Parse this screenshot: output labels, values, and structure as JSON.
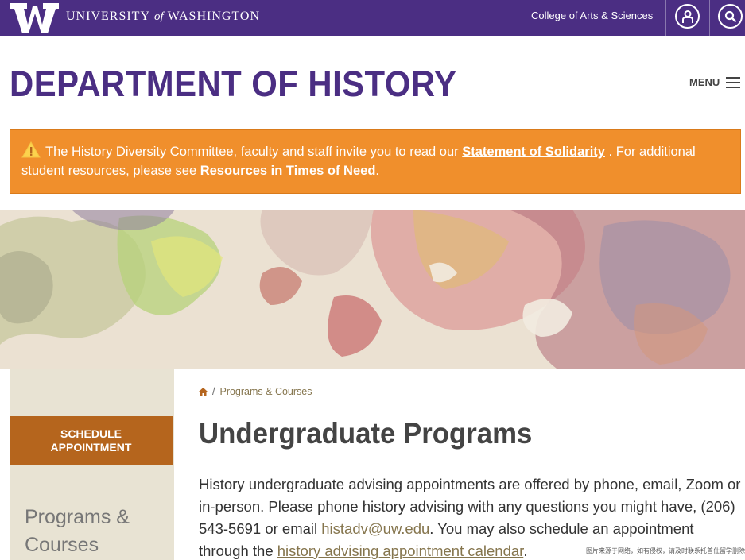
{
  "topbar": {
    "wordmark_pre": "UNIVERSITY",
    "wordmark_of": "of",
    "wordmark_post": "WASHINGTON",
    "college_link": "College of Arts & Sciences",
    "account_icon": "user-icon",
    "search_icon": "search-icon"
  },
  "header": {
    "title": "DEPARTMENT OF HISTORY",
    "menu_label": "MENU"
  },
  "alert": {
    "text_1": "The History Diversity Committee, faculty and staff invite you to read our ",
    "link_1": "Statement of Solidarity",
    "text_2": " . For additional student resources, please see ",
    "link_2": "Resources in Times of Need",
    "text_3": "."
  },
  "sidebar": {
    "schedule_line1": "SCHEDULE",
    "schedule_line2": "APPOINTMENT",
    "heading_line1": "Programs &",
    "heading_line2": "Courses"
  },
  "breadcrumb": {
    "separator": "/",
    "link": "Programs & Courses"
  },
  "main": {
    "title": "Undergraduate Programs",
    "para_1": "History undergraduate advising appointments are offered by phone, email, Zoom or in-person. Please phone history advising with any questions you might have, (206) 543-5691 or email ",
    "email_link": "histadv@uw.edu",
    "para_2": ". You may also schedule an appointment through the ",
    "calendar_link": "history advising appointment calendar",
    "para_3": "."
  },
  "watermark": "图片来源于网络，如有侵权，请及时联系托普仕留学删除",
  "colors": {
    "uw_purple": "#4b2e83",
    "alert_orange": "#f08f2c",
    "schedule_brown": "#b5651d",
    "link_gold": "#85754d"
  }
}
